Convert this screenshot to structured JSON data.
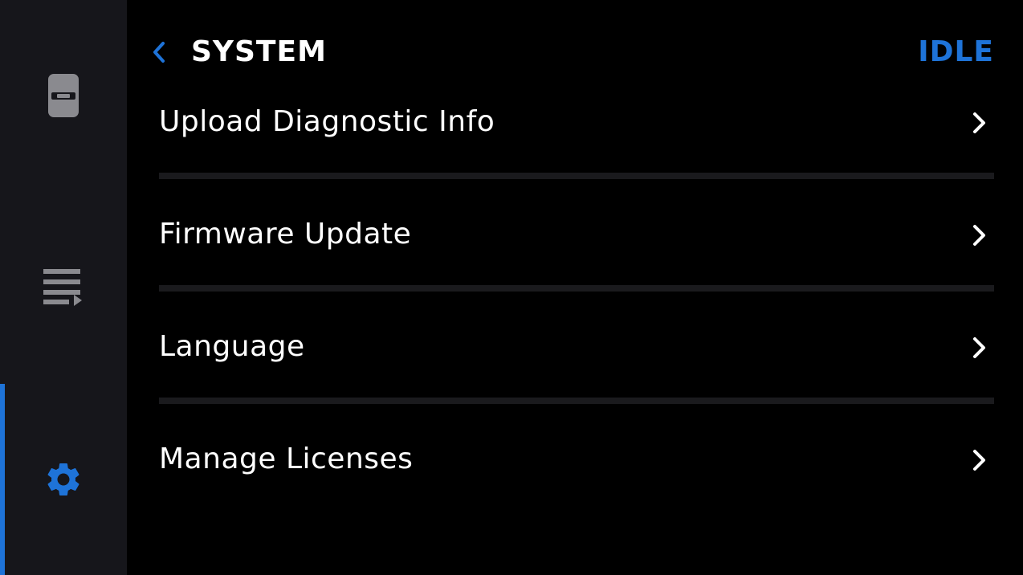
{
  "header": {
    "title": "SYSTEM",
    "status": "IDLE"
  },
  "sidebar": {
    "items": [
      {
        "icon": "robot-icon",
        "active": false
      },
      {
        "icon": "playlist-icon",
        "active": false
      },
      {
        "icon": "gear-icon",
        "active": true
      }
    ]
  },
  "menu": {
    "items": [
      {
        "label": "Upload Diagnostic Info"
      },
      {
        "label": "Firmware Update"
      },
      {
        "label": "Language"
      },
      {
        "label": "Manage Licenses"
      }
    ]
  },
  "colors": {
    "accent": "#1e73d8",
    "sidebar_bg": "#16161b",
    "icon_inactive": "#8a8a8f",
    "background": "#000000",
    "divider": "#1a1a1d"
  }
}
